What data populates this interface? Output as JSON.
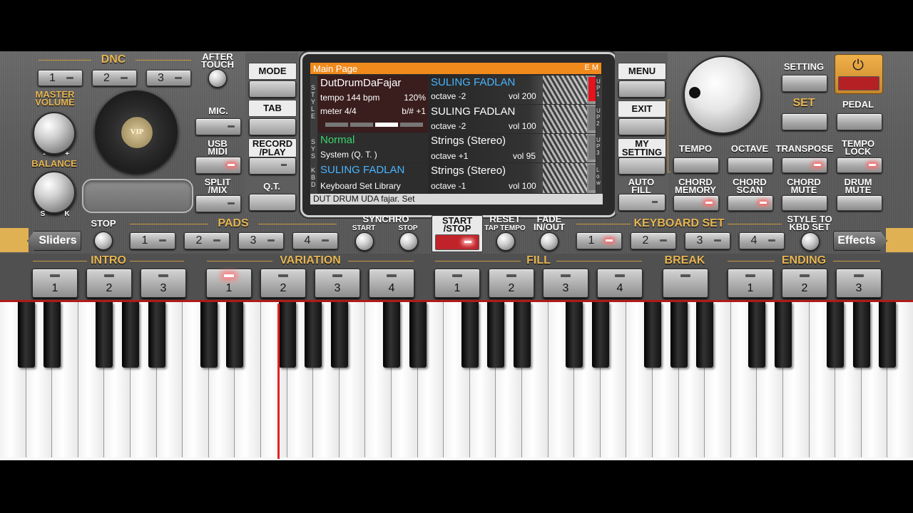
{
  "dnc": {
    "title": "DNC",
    "buttons": [
      "1",
      "2",
      "3"
    ]
  },
  "after_touch": "AFTER\nTOUCH",
  "master_volume": "MASTER\nVOLUME",
  "balance": {
    "label": "BALANCE",
    "left": "S",
    "right": "K",
    "minus": "-",
    "plus": "+"
  },
  "vip_logo": "VIP",
  "left_col": {
    "mic": "MIC.",
    "usb_midi": "USB\nMIDI",
    "split_mix": "SPLIT\n/MIX"
  },
  "mode_col": {
    "mode": "MODE",
    "tab": "TAB",
    "record_play": "RECORD\n/PLAY",
    "qt": "Q.T."
  },
  "screen": {
    "title": "Main Page",
    "em": "E M",
    "style_side": "STYLE",
    "sys_side": "SYS",
    "kbd_side": "KBD",
    "style_name": "DutDrumDaFajar",
    "tempo": "tempo 144 bpm",
    "percent": "120%",
    "meter": "meter 4/4",
    "bsharp": "b/# +1",
    "sys_name": "Normal",
    "sys_sub": "System (Q. T. )",
    "kbd_name": "SULING FADLAN",
    "kbd_sub": "Keyboard Set Library",
    "parts": [
      {
        "name": "SULING FADLAN",
        "octave": "octave -2",
        "vol": "vol 200",
        "side": "UP1"
      },
      {
        "name": "SULING FADLAN",
        "octave": "octave -2",
        "vol": "vol 100",
        "side": "UP2"
      },
      {
        "name": "Strings (Stereo)",
        "octave": "octave +1",
        "vol": "vol 95",
        "side": "UP3"
      },
      {
        "name": "Strings (Stereo)",
        "octave": "octave -1",
        "vol": "vol 100",
        "side": "Low"
      }
    ],
    "footer": "DUT DRUM UDA fajar. Set"
  },
  "right_col": {
    "menu": "MENU",
    "exit": "EXIT",
    "my_setting": "MY\nSETTING",
    "auto_fill": "AUTO\nFILL"
  },
  "setting": "SETTING",
  "set": "SET",
  "pedal": "PEDAL",
  "right_row1": [
    "TEMPO",
    "OCTAVE",
    "TRANSPOSE",
    "TEMPO\nLOCK"
  ],
  "right_row2": [
    "CHORD\nMEMORY",
    "CHORD\nSCAN",
    "CHORD\nMUTE",
    "DRUM\nMUTE"
  ],
  "strip": {
    "sliders": "Sliders",
    "stop": "STOP",
    "pads_title": "PADS",
    "pads": [
      "1",
      "2",
      "3",
      "4"
    ],
    "synchro": "SYNCHRO",
    "synchro_start": "START",
    "synchro_stop": "STOP",
    "start_stop": "START\n/STOP",
    "reset": "RESET",
    "tap_tempo": "TAP TEMPO",
    "fade": "FADE\nIN/OUT",
    "kbd_set_title": "KEYBOARD SET",
    "kbd_set": [
      "1",
      "2",
      "3",
      "4"
    ],
    "style_to_kbd": "STYLE TO\nKBD SET",
    "effects": "Effects"
  },
  "bottom": {
    "intro": {
      "title": "INTRO",
      "buttons": [
        "1",
        "2",
        "3"
      ]
    },
    "variation": {
      "title": "VARIATION",
      "buttons": [
        "1",
        "2",
        "3",
        "4"
      ]
    },
    "fill": {
      "title": "FILL",
      "buttons": [
        "1",
        "2",
        "3",
        "4"
      ]
    },
    "break": {
      "title": "BREAK"
    },
    "ending": {
      "title": "ENDING",
      "buttons": [
        "1",
        "2",
        "3"
      ]
    }
  },
  "colors": {
    "accent_gold": "#e7b654",
    "section_gold": "#c89a3e",
    "screen_header": "#f08a1c",
    "active_red": "#c0242a",
    "style_cyan": "#49b4ff",
    "sys_green": "#3dd36b"
  }
}
